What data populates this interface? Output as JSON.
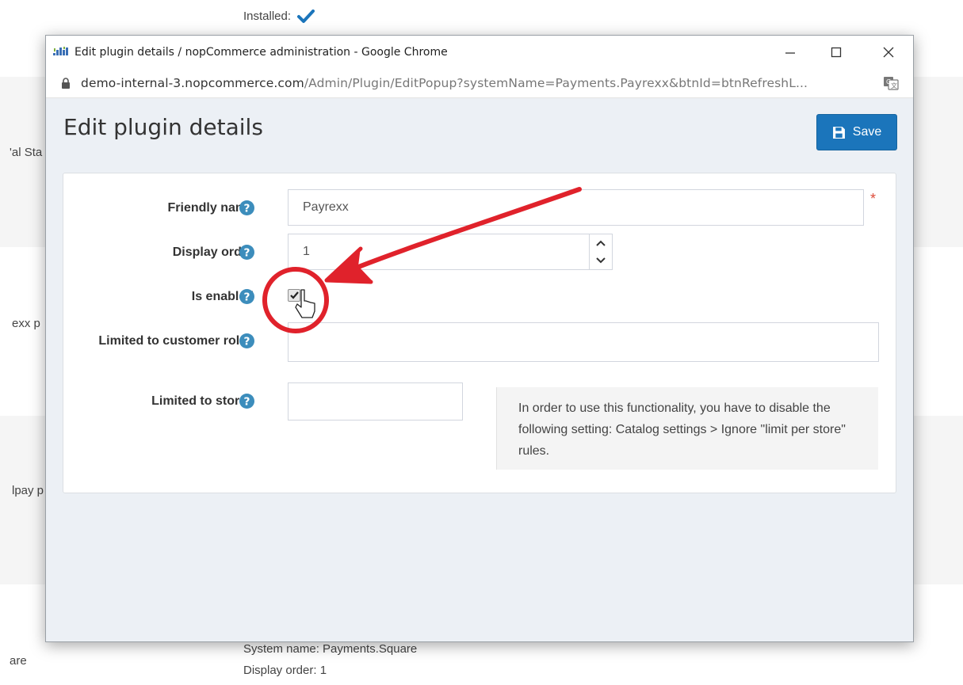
{
  "background": {
    "installed_label": "Installed:",
    "left_fragments": [
      "'al Sta",
      "exx p",
      "lpay p",
      "are"
    ],
    "bottom_system_name": "System name: Payments.Square",
    "bottom_display_order": "Display order: 1"
  },
  "window": {
    "title": "Edit plugin details / nopCommerce administration - Google Chrome",
    "url_host": "demo-internal-3.nopcommerce.com",
    "url_path": "/Admin/Plugin/EditPopup?systemName=Payments.Payrexx&btnId=btnRefreshL..."
  },
  "page": {
    "title": "Edit plugin details",
    "save_label": "Save"
  },
  "form": {
    "friendly_name_label": "Friendly name",
    "friendly_name_value": "Payrexx",
    "required_mark": "*",
    "display_order_label": "Display order",
    "display_order_value": "1",
    "is_enabled_label": "Is enabled",
    "is_enabled_checked": true,
    "customer_roles_label": "Limited to customer roles",
    "stores_label": "Limited to stores",
    "stores_note": "In order to use this functionality, you have to disable the following setting: Catalog settings > Ignore \"limit per store\" rules."
  },
  "colors": {
    "primary": "#1b75bb",
    "help_icon": "#3c8dbc",
    "annotation_red": "#e0222b",
    "required": "#dd4b39"
  },
  "icons": {
    "app": "nopcommerce-icon",
    "lock": "lock-icon",
    "translate": "translate-icon",
    "save": "floppy-disk-icon",
    "help": "question-circle-icon",
    "checkmark": "checkmark-icon"
  }
}
